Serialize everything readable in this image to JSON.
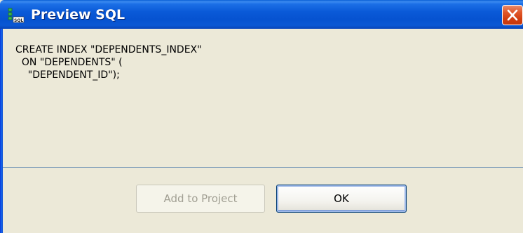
{
  "window": {
    "title": "Preview SQL",
    "icon": "sql-table-icon",
    "close_icon": "close-icon"
  },
  "sql": {
    "lines": [
      "CREATE INDEX \"DEPENDENTS_INDEX\"",
      "  ON \"DEPENDENTS\" (",
      "    \"DEPENDENT_ID\");"
    ]
  },
  "buttons": {
    "add_to_project": "Add to Project",
    "ok": "OK"
  },
  "colors": {
    "titlebar": "#0a58d4",
    "dialog_bg": "#ece9d8",
    "close_button": "#d23e10",
    "disabled_text": "#a19f93"
  }
}
